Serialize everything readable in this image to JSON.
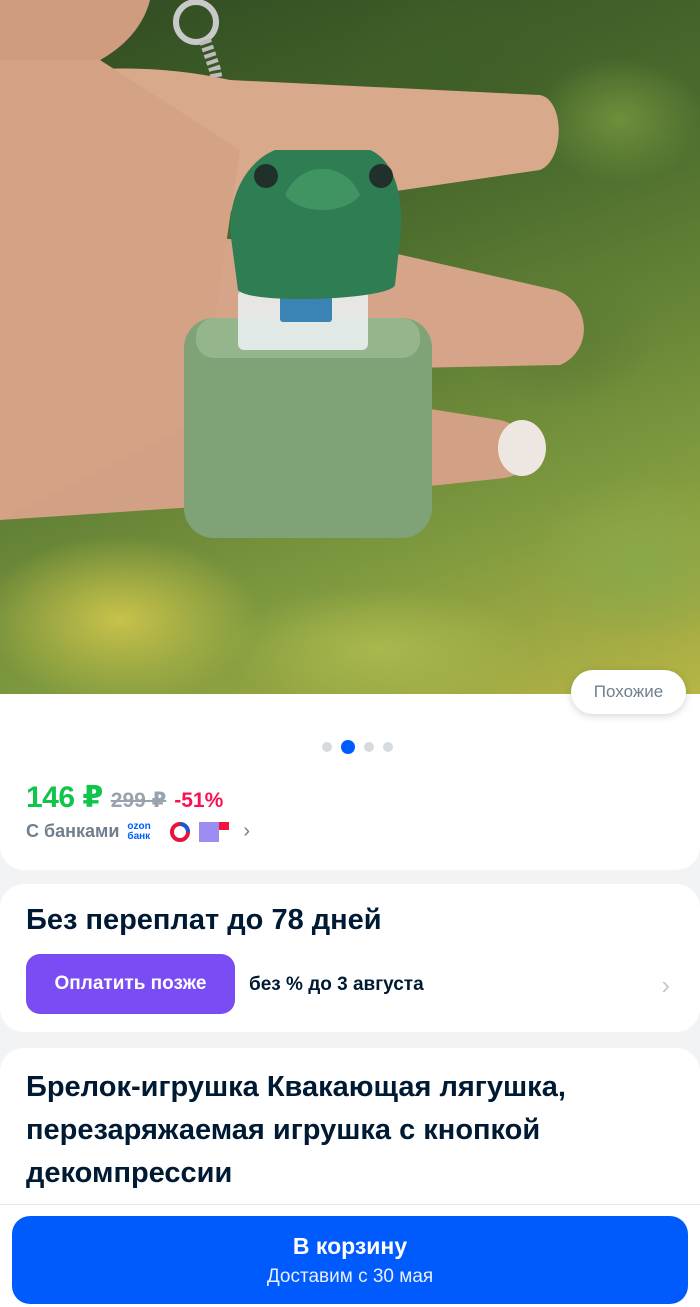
{
  "gallery": {
    "similar_label": "Похожие",
    "slide_count": 4,
    "active_slide": 2
  },
  "price": {
    "current": "146 ₽",
    "old": "299 ₽",
    "discount": "-51%",
    "banks_label": "С банками",
    "ozon_bank_top": "ozon",
    "ozon_bank_bottom": "банк"
  },
  "installment": {
    "title": "Без переплат до 78 дней",
    "pay_later_label": "Оплатить позже",
    "description": "без % до 3 августа"
  },
  "product": {
    "title": "Брелок-игрушка Квакающая лягушка, перезаряжаемая игрушка с кнопкой декомпрессии"
  },
  "cart": {
    "label": "В корзину",
    "delivery": "Доставим с 30 мая"
  },
  "colors": {
    "accent": "#005bff",
    "price_green": "#10c44c",
    "discount_pink": "#f91155",
    "pay_later_purple": "#7a4cf4"
  }
}
